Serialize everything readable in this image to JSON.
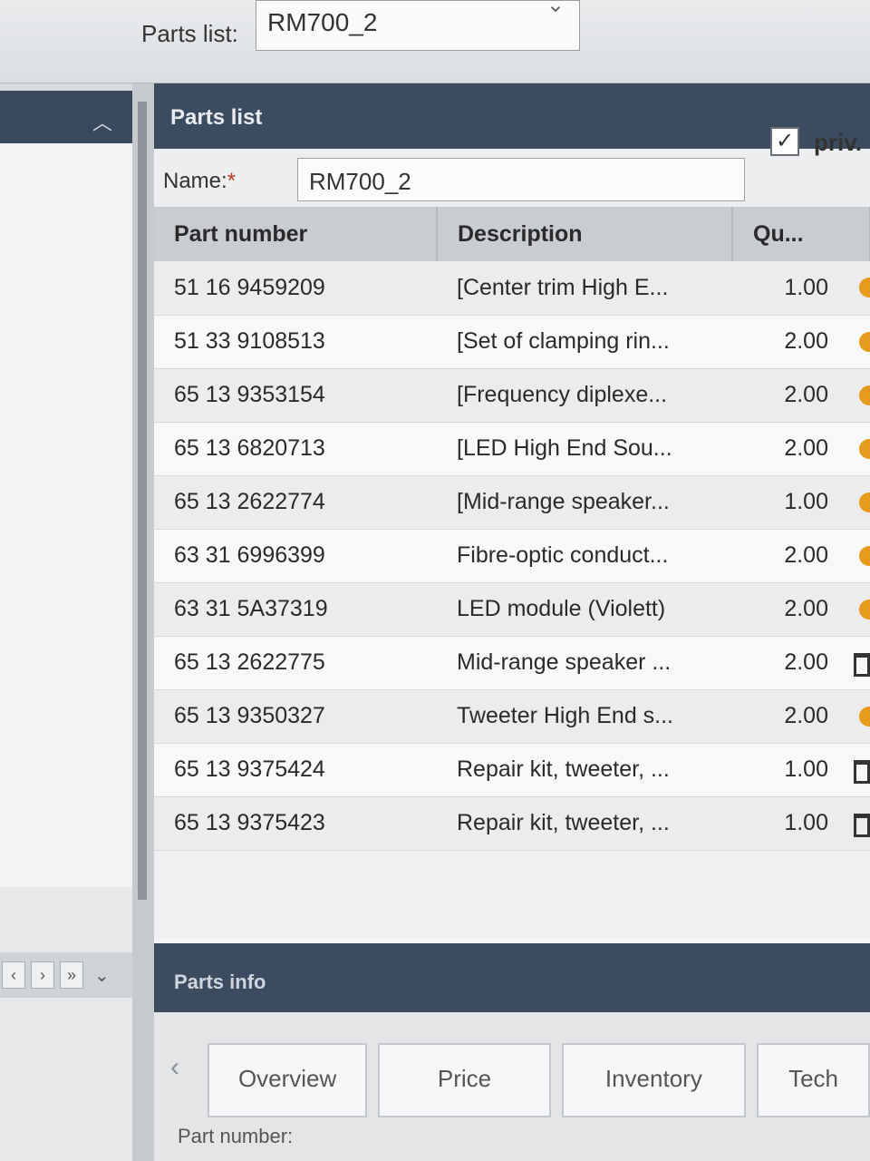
{
  "top": {
    "parts_list_label": "Parts list:",
    "parts_list_value": "RM700_2"
  },
  "panel": {
    "title": "Parts list",
    "name_label": "Name:",
    "required_mark": "*",
    "name_value": "RM700_2",
    "priv_label": "priv.",
    "priv_checked": true
  },
  "columns": {
    "part_number": "Part number",
    "description": "Description",
    "quantity": "Qu..."
  },
  "rows": [
    {
      "part": "51 16 9459209",
      "desc": "[Center trim High E...",
      "qty": "1.00",
      "status": "dot"
    },
    {
      "part": "51 33 9108513",
      "desc": "[Set of clamping rin...",
      "qty": "2.00",
      "status": "dot"
    },
    {
      "part": "65 13 9353154",
      "desc": "[Frequency diplexe...",
      "qty": "2.00",
      "status": "dot"
    },
    {
      "part": "65 13 6820713",
      "desc": "[LED High End Sou...",
      "qty": "2.00",
      "status": "dot"
    },
    {
      "part": "65 13 2622774",
      "desc": "[Mid-range speaker...",
      "qty": "1.00",
      "status": "dot"
    },
    {
      "part": "63 31 6996399",
      "desc": "Fibre-optic conduct...",
      "qty": "2.00",
      "status": "dot"
    },
    {
      "part": "63 31 5A37319",
      "desc": "LED module (Violett)",
      "qty": "2.00",
      "status": "dot"
    },
    {
      "part": "65 13 2622775",
      "desc": "Mid-range speaker ...",
      "qty": "2.00",
      "status": "trash"
    },
    {
      "part": "65 13 9350327",
      "desc": "Tweeter High End s...",
      "qty": "2.00",
      "status": "dot"
    },
    {
      "part": "65 13 9375424",
      "desc": "Repair kit, tweeter, ...",
      "qty": "1.00",
      "status": "trash"
    },
    {
      "part": "65 13 9375423",
      "desc": "Repair kit, tweeter, ...",
      "qty": "1.00",
      "status": "trash"
    }
  ],
  "parts_info": {
    "title": "Parts info",
    "tabs": [
      "Overview",
      "Price",
      "Inventory",
      "Tech"
    ],
    "part_number_label": "Part number:"
  },
  "colors": {
    "header": "#3b4c61",
    "status_dot": "#e69a1e"
  },
  "icons": {
    "collapse": "chevron-up-icon",
    "tab_back": "chevron-left-icon",
    "delete": "trash-icon"
  }
}
